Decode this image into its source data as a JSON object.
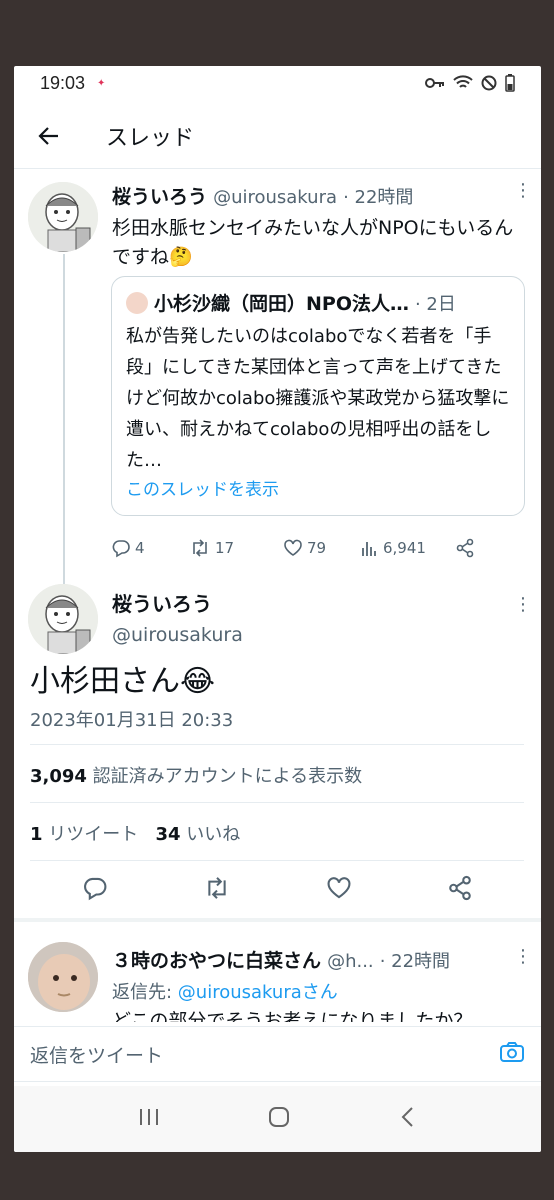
{
  "status": {
    "time": "19:03"
  },
  "header": {
    "title": "スレッド"
  },
  "tweet1": {
    "name": "桜ういろう",
    "handle": "@uirousakura",
    "time": "· 22時間",
    "text": "杉田水脈センセイみたいな人がNPOにもいるんですね🤔",
    "quote": {
      "name": "小杉沙織（岡田）NPO法人…",
      "time": "· 2日",
      "text": "私が告発したいのはcolaboでなく若者を「手段」にしてきた某団体と言って声を上げてきたけど何故かcolabo擁護派や某政党から猛攻撃に遭い、耐えかねてcolaboの児相呼出の話をした…",
      "link": "このスレッドを表示"
    },
    "stats": {
      "replies": "4",
      "retweets": "17",
      "likes": "79",
      "views": "6,941"
    }
  },
  "tweet2": {
    "name": "桜ういろう",
    "handle": "@uirousakura",
    "text": "小杉田さん😂",
    "datetime": "2023年01月31日 20:33",
    "views_count": "3,094",
    "views_label": "認証済みアカウントによる表示数",
    "rt_count": "1",
    "rt_label": "リツイート",
    "like_count": "34",
    "like_label": "いいね"
  },
  "reply3": {
    "name": "３時のおやつに白菜さん",
    "handle": "@h...",
    "time": "· 22時間",
    "to_label": "返信先: ",
    "to_handle": "@uirousakuraさん",
    "text": "どこの部分でそうお考えになりましたか？"
  },
  "composer": {
    "placeholder": "返信をツイート"
  }
}
